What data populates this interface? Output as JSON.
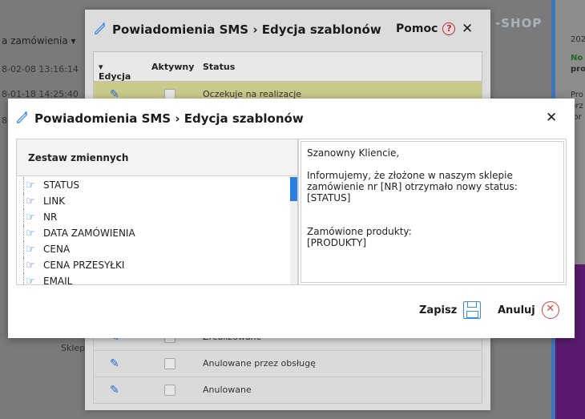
{
  "background": {
    "left_header": "a zamówienia",
    "left_rows": [
      "8-02-08 13:16:14",
      "8-01-18 14:25:40",
      "8-"
    ],
    "left_bottom": "Sklep",
    "shop_logo": "-SHOP",
    "right_texts": [
      "202",
      "No",
      "pro",
      "Pro",
      "prz",
      "for"
    ]
  },
  "modal_back": {
    "title": "Powiadomienia SMS › Edycja szablonów",
    "help_label": "Pomoc",
    "help_icon_text": "?",
    "close_label": "✕",
    "columns": [
      "Edycja",
      "Aktywny",
      "Status"
    ],
    "rows": [
      {
        "status": "Oczekuje na realizacje"
      },
      {
        "status": "Zrealizowane"
      },
      {
        "status": "Anulowane przez obsługę"
      },
      {
        "status": "Anulowane"
      }
    ]
  },
  "modal_front": {
    "title": "Powiadomienia SMS › Edycja szablonów",
    "close_label": "✕",
    "vars_header": "Zestaw zmiennych",
    "variables": [
      "STATUS",
      "LINK",
      "NR",
      "DATA ZAMÓWIENIA",
      "CENA",
      "CENA PRZESYŁKI",
      "EMAIL"
    ],
    "message": [
      "Szanowny Kliencie,",
      "Informujemy, że złożone w naszym sklepie\nzamówienie nr [NR] otrzymało nowy status: [STATUS]",
      "\nZamówione produkty:\n[PRODUKTY]"
    ],
    "save_label": "Zapisz",
    "cancel_label": "Anuluj",
    "cancel_icon_text": "✕"
  },
  "colors": {
    "accent": "#2a7de1",
    "danger": "#d84040",
    "highlight_row": "#c9c98a"
  }
}
